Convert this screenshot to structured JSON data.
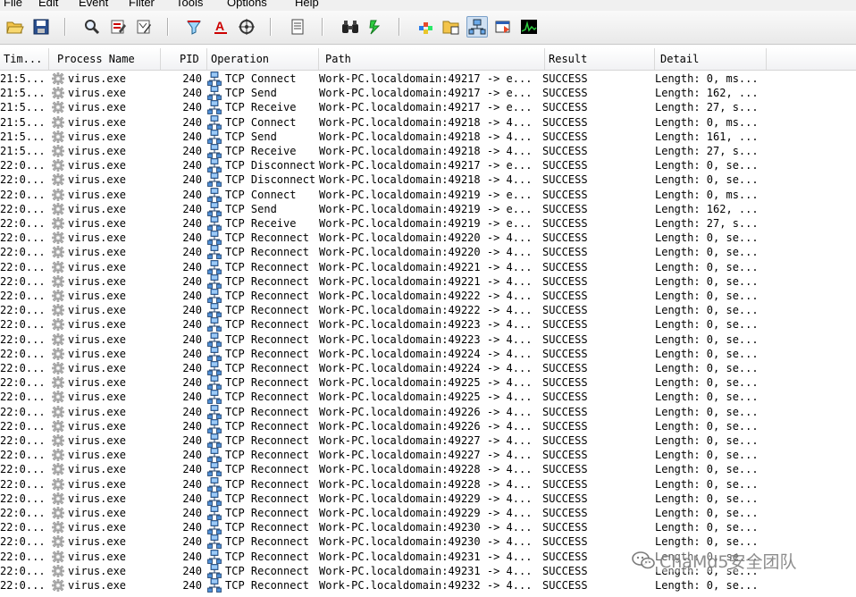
{
  "menu": [
    "File",
    "Edit",
    "Event",
    "Filter",
    "Tools",
    "Options",
    "Help"
  ],
  "toolbar": {
    "buttons": [
      {
        "name": "open-icon"
      },
      {
        "name": "save-icon"
      },
      {
        "name": "find-icon"
      },
      {
        "name": "highlight-icon"
      },
      {
        "name": "filter-edit-icon"
      },
      {
        "name": "filter-icon"
      },
      {
        "name": "highlight-text-icon"
      },
      {
        "name": "target-icon"
      },
      {
        "name": "properties-icon"
      },
      {
        "name": "binoculars-icon"
      },
      {
        "name": "jump-icon"
      },
      {
        "name": "registry-activity-icon"
      },
      {
        "name": "file-activity-icon"
      },
      {
        "name": "network-activity-icon"
      },
      {
        "name": "process-activity-icon"
      },
      {
        "name": "profiling-icon"
      }
    ],
    "pressed": "network-activity-icon"
  },
  "columns": [
    "Tim...",
    "Process Name",
    "PID",
    "Operation",
    "Path",
    "Result",
    "Detail"
  ],
  "rows": [
    {
      "time": "21:5...",
      "process": "virus.exe",
      "pid": "240",
      "operation": "TCP Connect",
      "path": "Work-PC.localdomain:49217 -> e...",
      "result": "SUCCESS",
      "detail": "Length: 0, ms..."
    },
    {
      "time": "21:5...",
      "process": "virus.exe",
      "pid": "240",
      "operation": "TCP Send",
      "path": "Work-PC.localdomain:49217 -> e...",
      "result": "SUCCESS",
      "detail": "Length: 162, ..."
    },
    {
      "time": "21:5...",
      "process": "virus.exe",
      "pid": "240",
      "operation": "TCP Receive",
      "path": "Work-PC.localdomain:49217 -> e...",
      "result": "SUCCESS",
      "detail": "Length: 27, s..."
    },
    {
      "time": "21:5...",
      "process": "virus.exe",
      "pid": "240",
      "operation": "TCP Connect",
      "path": "Work-PC.localdomain:49218 -> 4...",
      "result": "SUCCESS",
      "detail": "Length: 0, ms..."
    },
    {
      "time": "21:5...",
      "process": "virus.exe",
      "pid": "240",
      "operation": "TCP Send",
      "path": "Work-PC.localdomain:49218 -> 4...",
      "result": "SUCCESS",
      "detail": "Length: 161, ..."
    },
    {
      "time": "21:5...",
      "process": "virus.exe",
      "pid": "240",
      "operation": "TCP Receive",
      "path": "Work-PC.localdomain:49218 -> 4...",
      "result": "SUCCESS",
      "detail": "Length: 27, s..."
    },
    {
      "time": "22:0...",
      "process": "virus.exe",
      "pid": "240",
      "operation": "TCP Disconnect",
      "path": "Work-PC.localdomain:49217 -> e...",
      "result": "SUCCESS",
      "detail": "Length: 0, se..."
    },
    {
      "time": "22:0...",
      "process": "virus.exe",
      "pid": "240",
      "operation": "TCP Disconnect",
      "path": "Work-PC.localdomain:49218 -> 4...",
      "result": "SUCCESS",
      "detail": "Length: 0, se..."
    },
    {
      "time": "22:0...",
      "process": "virus.exe",
      "pid": "240",
      "operation": "TCP Connect",
      "path": "Work-PC.localdomain:49219 -> e...",
      "result": "SUCCESS",
      "detail": "Length: 0, ms..."
    },
    {
      "time": "22:0...",
      "process": "virus.exe",
      "pid": "240",
      "operation": "TCP Send",
      "path": "Work-PC.localdomain:49219 -> e...",
      "result": "SUCCESS",
      "detail": "Length: 162, ..."
    },
    {
      "time": "22:0...",
      "process": "virus.exe",
      "pid": "240",
      "operation": "TCP Receive",
      "path": "Work-PC.localdomain:49219 -> e...",
      "result": "SUCCESS",
      "detail": "Length: 27, s..."
    },
    {
      "time": "22:0...",
      "process": "virus.exe",
      "pid": "240",
      "operation": "TCP Reconnect",
      "path": "Work-PC.localdomain:49220 -> 4...",
      "result": "SUCCESS",
      "detail": "Length: 0, se..."
    },
    {
      "time": "22:0...",
      "process": "virus.exe",
      "pid": "240",
      "operation": "TCP Reconnect",
      "path": "Work-PC.localdomain:49220 -> 4...",
      "result": "SUCCESS",
      "detail": "Length: 0, se..."
    },
    {
      "time": "22:0...",
      "process": "virus.exe",
      "pid": "240",
      "operation": "TCP Reconnect",
      "path": "Work-PC.localdomain:49221 -> 4...",
      "result": "SUCCESS",
      "detail": "Length: 0, se..."
    },
    {
      "time": "22:0...",
      "process": "virus.exe",
      "pid": "240",
      "operation": "TCP Reconnect",
      "path": "Work-PC.localdomain:49221 -> 4...",
      "result": "SUCCESS",
      "detail": "Length: 0, se..."
    },
    {
      "time": "22:0...",
      "process": "virus.exe",
      "pid": "240",
      "operation": "TCP Reconnect",
      "path": "Work-PC.localdomain:49222 -> 4...",
      "result": "SUCCESS",
      "detail": "Length: 0, se..."
    },
    {
      "time": "22:0...",
      "process": "virus.exe",
      "pid": "240",
      "operation": "TCP Reconnect",
      "path": "Work-PC.localdomain:49222 -> 4...",
      "result": "SUCCESS",
      "detail": "Length: 0, se..."
    },
    {
      "time": "22:0...",
      "process": "virus.exe",
      "pid": "240",
      "operation": "TCP Reconnect",
      "path": "Work-PC.localdomain:49223 -> 4...",
      "result": "SUCCESS",
      "detail": "Length: 0, se..."
    },
    {
      "time": "22:0...",
      "process": "virus.exe",
      "pid": "240",
      "operation": "TCP Reconnect",
      "path": "Work-PC.localdomain:49223 -> 4...",
      "result": "SUCCESS",
      "detail": "Length: 0, se..."
    },
    {
      "time": "22:0...",
      "process": "virus.exe",
      "pid": "240",
      "operation": "TCP Reconnect",
      "path": "Work-PC.localdomain:49224 -> 4...",
      "result": "SUCCESS",
      "detail": "Length: 0, se..."
    },
    {
      "time": "22:0...",
      "process": "virus.exe",
      "pid": "240",
      "operation": "TCP Reconnect",
      "path": "Work-PC.localdomain:49224 -> 4...",
      "result": "SUCCESS",
      "detail": "Length: 0, se..."
    },
    {
      "time": "22:0...",
      "process": "virus.exe",
      "pid": "240",
      "operation": "TCP Reconnect",
      "path": "Work-PC.localdomain:49225 -> 4...",
      "result": "SUCCESS",
      "detail": "Length: 0, se..."
    },
    {
      "time": "22:0...",
      "process": "virus.exe",
      "pid": "240",
      "operation": "TCP Reconnect",
      "path": "Work-PC.localdomain:49225 -> 4...",
      "result": "SUCCESS",
      "detail": "Length: 0, se..."
    },
    {
      "time": "22:0...",
      "process": "virus.exe",
      "pid": "240",
      "operation": "TCP Reconnect",
      "path": "Work-PC.localdomain:49226 -> 4...",
      "result": "SUCCESS",
      "detail": "Length: 0, se..."
    },
    {
      "time": "22:0...",
      "process": "virus.exe",
      "pid": "240",
      "operation": "TCP Reconnect",
      "path": "Work-PC.localdomain:49226 -> 4...",
      "result": "SUCCESS",
      "detail": "Length: 0, se..."
    },
    {
      "time": "22:0...",
      "process": "virus.exe",
      "pid": "240",
      "operation": "TCP Reconnect",
      "path": "Work-PC.localdomain:49227 -> 4...",
      "result": "SUCCESS",
      "detail": "Length: 0, se..."
    },
    {
      "time": "22:0...",
      "process": "virus.exe",
      "pid": "240",
      "operation": "TCP Reconnect",
      "path": "Work-PC.localdomain:49227 -> 4...",
      "result": "SUCCESS",
      "detail": "Length: 0, se..."
    },
    {
      "time": "22:0...",
      "process": "virus.exe",
      "pid": "240",
      "operation": "TCP Reconnect",
      "path": "Work-PC.localdomain:49228 -> 4...",
      "result": "SUCCESS",
      "detail": "Length: 0, se..."
    },
    {
      "time": "22:0...",
      "process": "virus.exe",
      "pid": "240",
      "operation": "TCP Reconnect",
      "path": "Work-PC.localdomain:49228 -> 4...",
      "result": "SUCCESS",
      "detail": "Length: 0, se..."
    },
    {
      "time": "22:0...",
      "process": "virus.exe",
      "pid": "240",
      "operation": "TCP Reconnect",
      "path": "Work-PC.localdomain:49229 -> 4...",
      "result": "SUCCESS",
      "detail": "Length: 0, se..."
    },
    {
      "time": "22:0...",
      "process": "virus.exe",
      "pid": "240",
      "operation": "TCP Reconnect",
      "path": "Work-PC.localdomain:49229 -> 4...",
      "result": "SUCCESS",
      "detail": "Length: 0, se..."
    },
    {
      "time": "22:0...",
      "process": "virus.exe",
      "pid": "240",
      "operation": "TCP Reconnect",
      "path": "Work-PC.localdomain:49230 -> 4...",
      "result": "SUCCESS",
      "detail": "Length: 0, se..."
    },
    {
      "time": "22:0...",
      "process": "virus.exe",
      "pid": "240",
      "operation": "TCP Reconnect",
      "path": "Work-PC.localdomain:49230 -> 4...",
      "result": "SUCCESS",
      "detail": "Length: 0, se..."
    },
    {
      "time": "22:0...",
      "process": "virus.exe",
      "pid": "240",
      "operation": "TCP Reconnect",
      "path": "Work-PC.localdomain:49231 -> 4...",
      "result": "SUCCESS",
      "detail": "Length: 0, se..."
    },
    {
      "time": "22:0...",
      "process": "virus.exe",
      "pid": "240",
      "operation": "TCP Reconnect",
      "path": "Work-PC.localdomain:49231 -> 4...",
      "result": "SUCCESS",
      "detail": "Length: 0, se..."
    },
    {
      "time": "22:0...",
      "process": "virus.exe",
      "pid": "240",
      "operation": "TCP Reconnect",
      "path": "Work-PC.localdomain:49232 -> 4...",
      "result": "SUCCESS",
      "detail": "Length: 0, se..."
    }
  ],
  "watermark": "ChaMd5安全团队"
}
